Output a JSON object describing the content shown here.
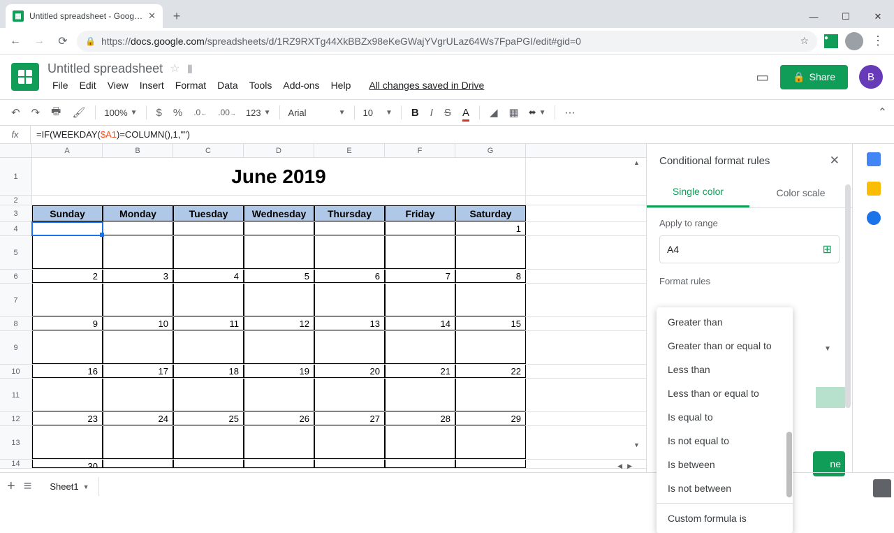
{
  "browser": {
    "tab_title": "Untitled spreadsheet - Google S",
    "url_host": "docs.google.com",
    "url_path": "/spreadsheets/d/1RZ9RXTg44XkBBZx98eKeGWajYVgrULaz64Ws7FpaPGI/edit#gid=0"
  },
  "doc": {
    "title": "Untitled spreadsheet",
    "saved": "All changes saved in Drive",
    "share": "Share",
    "user_initial": "B"
  },
  "menus": [
    "File",
    "Edit",
    "View",
    "Insert",
    "Format",
    "Data",
    "Tools",
    "Add-ons",
    "Help"
  ],
  "toolbar": {
    "zoom": "100%",
    "currency": "$",
    "percent": "%",
    "dec_dec": ".0",
    "dec_inc": ".00",
    "num_fmt": "123",
    "font": "Arial",
    "size": "10"
  },
  "formula": {
    "prefix": "=IF(WEEKDAY(",
    "ref": "$A1",
    "suffix": ")=COLUMN(),1,\"\")"
  },
  "sheet": {
    "columns": [
      "A",
      "B",
      "C",
      "D",
      "E",
      "F",
      "G"
    ],
    "title": "June 2019",
    "days": [
      "Sunday",
      "Monday",
      "Tuesday",
      "Wednesday",
      "Thursday",
      "Friday",
      "Saturday"
    ],
    "weeks": [
      {
        "row": 4,
        "vals": [
          "",
          "",
          "",
          "",
          "",
          "",
          "1"
        ]
      },
      {
        "row": 6,
        "vals": [
          "2",
          "3",
          "4",
          "5",
          "6",
          "7",
          "8"
        ]
      },
      {
        "row": 8,
        "vals": [
          "9",
          "10",
          "11",
          "12",
          "13",
          "14",
          "15"
        ]
      },
      {
        "row": 10,
        "vals": [
          "16",
          "17",
          "18",
          "19",
          "20",
          "21",
          "22"
        ]
      },
      {
        "row": 12,
        "vals": [
          "23",
          "24",
          "25",
          "26",
          "27",
          "28",
          "29"
        ]
      },
      {
        "row": 14,
        "vals": [
          "30",
          "",
          "",
          "",
          "",
          "",
          ""
        ]
      }
    ],
    "tab_name": "Sheet1"
  },
  "panel": {
    "title": "Conditional format rules",
    "tabs": {
      "single": "Single color",
      "scale": "Color scale"
    },
    "apply_label": "Apply to range",
    "range": "A4",
    "rules_label": "Format rules",
    "options": [
      "Greater than",
      "Greater than or equal to",
      "Less than",
      "Less than or equal to",
      "Is equal to",
      "Is not equal to",
      "Is between",
      "Is not between",
      "Custom formula is"
    ],
    "done_tail": "ne"
  }
}
